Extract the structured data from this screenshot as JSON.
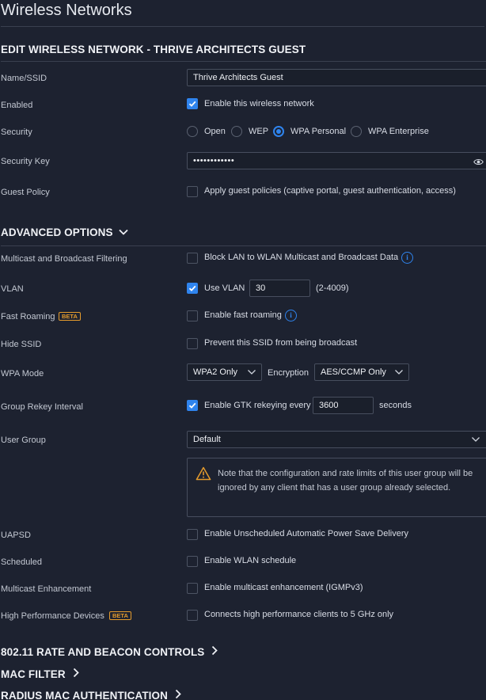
{
  "page_title": "Wireless Networks",
  "edit_section": {
    "heading": "EDIT WIRELESS NETWORK - THRIVE ARCHITECTS GUEST",
    "name_label": "Name/SSID",
    "name_value": "Thrive Architects Guest",
    "enabled_label": "Enabled",
    "enabled_text": "Enable this wireless network",
    "security_label": "Security",
    "security_options": [
      "Open",
      "WEP",
      "WPA Personal",
      "WPA Enterprise"
    ],
    "security_selected": "WPA Personal",
    "key_label": "Security Key",
    "key_value": "••••••••••••",
    "guest_label": "Guest Policy",
    "guest_text": "Apply guest policies (captive portal, guest authentication, access)"
  },
  "advanced": {
    "heading": "ADVANCED OPTIONS",
    "multicast_label": "Multicast and Broadcast Filtering",
    "multicast_text": "Block LAN to WLAN Multicast and Broadcast Data",
    "vlan_label": "VLAN",
    "vlan_text": "Use VLAN",
    "vlan_value": "30",
    "vlan_range": "(2-4009)",
    "roaming_label": "Fast Roaming",
    "beta_badge": "BETA",
    "roaming_text": "Enable fast roaming",
    "hide_label": "Hide SSID",
    "hide_text": "Prevent this SSID from being broadcast",
    "wpa_label": "WPA Mode",
    "wpa_value": "WPA2 Only",
    "encryption_label": "Encryption",
    "encryption_value": "AES/CCMP Only",
    "rekey_label": "Group Rekey Interval",
    "rekey_text": "Enable GTK rekeying every",
    "rekey_value": "3600",
    "rekey_unit": "seconds",
    "usergroup_label": "User Group",
    "usergroup_value": "Default",
    "usergroup_note": "Note that the configuration and rate limits of this user group will be ignored by any client that has a user group already selected.",
    "uapsd_label": "UAPSD",
    "uapsd_text": "Enable Unscheduled Automatic Power Save Delivery",
    "scheduled_label": "Scheduled",
    "scheduled_text": "Enable WLAN schedule",
    "mcast_enh_label": "Multicast Enhancement",
    "mcast_enh_text": "Enable multicast enhancement (IGMPv3)",
    "hpd_label": "High Performance Devices",
    "hpd_text": "Connects high performance clients to 5 GHz only"
  },
  "collapsed_sections": [
    "802.11 RATE AND BEACON CONTROLS",
    "MAC FILTER",
    "RADIUS MAC AUTHENTICATION"
  ],
  "colors": {
    "background": "#1d2230",
    "accent": "#2f84ee",
    "beta": "#e49b2d",
    "warning": "#e49b2d"
  }
}
